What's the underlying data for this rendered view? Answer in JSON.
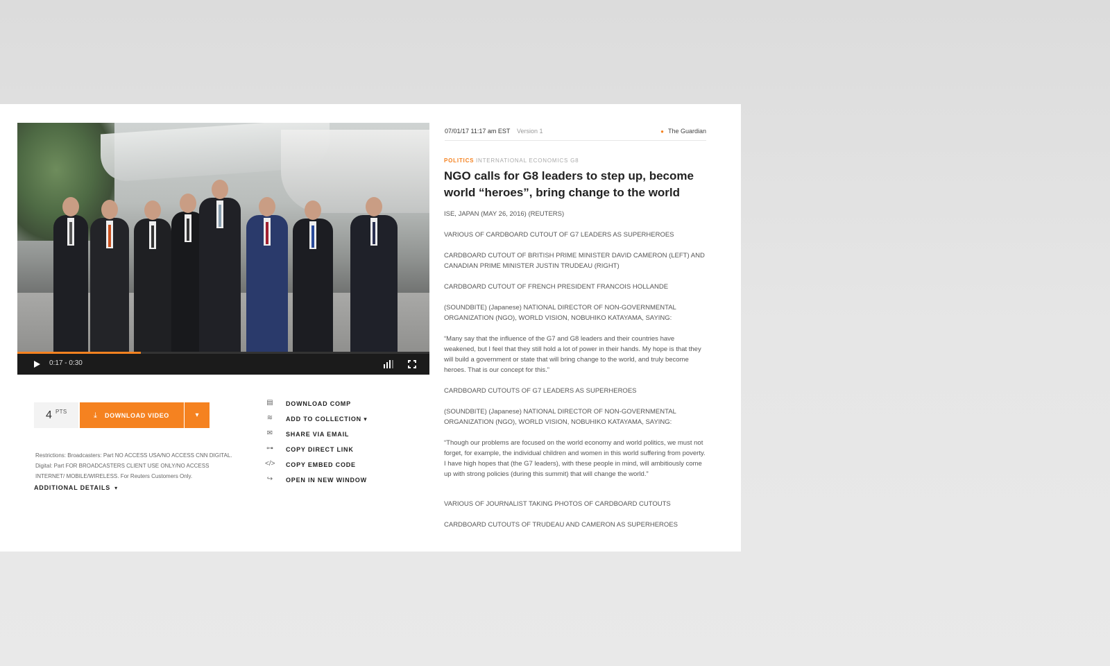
{
  "player": {
    "time_display": "0:17 - 0:30",
    "progress_fraction": 0.3
  },
  "actions": {
    "points_value": "4",
    "points_label": "PTS",
    "download_label": "DOWNLOAD VIDEO",
    "menu": [
      {
        "label": "DOWNLOAD  COMP",
        "icon": "film-icon"
      },
      {
        "label": "ADD TO COLLECTION",
        "icon": "layers-icon"
      },
      {
        "label": "SHARE VIA EMAIL",
        "icon": "mail-icon"
      },
      {
        "label": "COPY DIRECT LINK",
        "icon": "link-icon"
      },
      {
        "label": "COPY EMBED CODE",
        "icon": "code-icon"
      },
      {
        "label": "OPEN IN NEW WINDOW",
        "icon": "share-arrow-icon"
      }
    ],
    "restrictions": "Restrictions: Broadcasters: Part NO ACCESS USA/NO ACCESS CNN DIGITAL. Digital: Part FOR BROADCASTERS CLIENT USE ONLY/NO ACCESS INTERNET/ MOBILE/WIRELESS. For Reuters Customers Only.",
    "additional_details": "ADDITIONAL DETAILS"
  },
  "article": {
    "timestamp": "07/01/17 11:17 am EST",
    "version": "Version 1",
    "source": "The Guardian",
    "category": "POLITICS",
    "tags": "INTERNATIONAL ECONOMICS G8",
    "headline": "NGO calls for G8 leaders to step up, become world “heroes”, bring change to the world",
    "paragraphs": [
      "ISE, JAPAN (MAY 26, 2016) (REUTERS)",
      "VARIOUS OF CARDBOARD CUTOUT OF G7 LEADERS AS SUPERHEROES",
      "CARDBOARD CUTOUT OF BRITISH PRIME MINISTER DAVID CAMERON (LEFT) AND CANADIAN PRIME MINISTER JUSTIN TRUDEAU (RIGHT)",
      "CARDBOARD CUTOUT OF FRENCH PRESIDENT FRANCOIS HOLLANDE",
      "(SOUNDBITE) (Japanese) NATIONAL DIRECTOR OF NON-GOVERNMENTAL ORGANIZATION (NGO), WORLD VISION, NOBUHIKO KATAYAMA, SAYING:",
      "“Many say that the influence of the G7 and G8 leaders and their countries have weakened, but I feel that they still hold a lot of power in their hands. My hope is that they will build a government or state that will bring change to the world, and truly become heroes. That is our concept for this.”",
      "CARDBOARD CUTOUTS OF G7 LEADERS AS SUPERHEROES",
      "(SOUNDBITE) (Japanese) NATIONAL DIRECTOR OF NON-GOVERNMENTAL ORGANIZATION (NGO), WORLD VISION, NOBUHIKO KATAYAMA, SAYING:",
      "“Though our problems are focused on the world economy and world politics, we must not forget, for example, the individual children and women in this world suffering from poverty. I have high hopes that (the G7 leaders), with these people in mind, will ambitiously come up with strong policies (during this summit) that will change the world.”",
      "VARIOUS OF JOURNALIST TAKING PHOTOS OF CARDBOARD CUTOUTS",
      "CARDBOARD CUTOUTS OF TRUDEAU AND CAMERON AS SUPERHEROES"
    ]
  },
  "colors": {
    "accent": "#f58220",
    "player_bar": "#1b1b1b"
  }
}
